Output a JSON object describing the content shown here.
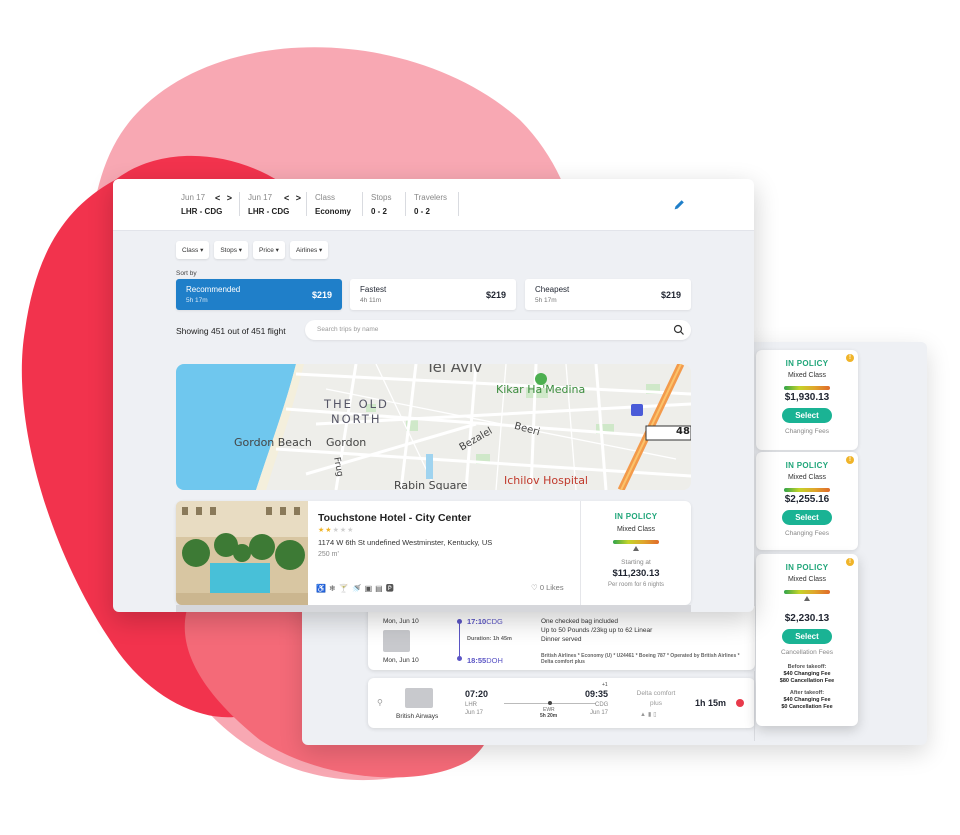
{
  "colors": {
    "accent": "#1f7fc9",
    "policy_green": "#21a67a",
    "select_teal": "#1ab394",
    "blob_red": "#f2334d",
    "blob_pink": "#f8a8b3"
  },
  "search_bar": {
    "departure": {
      "date": "Jun 17",
      "route": "LHR - CDG"
    },
    "return": {
      "date": "Jun 17",
      "route": "LHR - CDG"
    },
    "class": {
      "label": "Class",
      "value": "Economy"
    },
    "stops": {
      "label": "Stops",
      "value": "0 - 2"
    },
    "travelers": {
      "label": "Travelers",
      "value": "0 - 2"
    },
    "nav_arrows": "< >",
    "edit_icon": "pencil-icon"
  },
  "filters": [
    "Class",
    "Stops",
    "Price",
    "Airlines"
  ],
  "sort": {
    "label": "Sort by",
    "options": [
      {
        "name": "Recommended",
        "time": "5h 17m",
        "price": "$219",
        "active": true
      },
      {
        "name": "Fastest",
        "time": "4h 11m",
        "price": "$219",
        "active": false
      },
      {
        "name": "Cheapest",
        "time": "5h 17m",
        "price": "$219",
        "active": false
      }
    ]
  },
  "results": {
    "showing": "Showing 451 out of 451 flight",
    "search_placeholder": "Search trips by name"
  },
  "map": {
    "labels": [
      "Tel Aviv",
      "Kikar Ha'Medina",
      "THE OLD",
      "NORTH",
      "Gordon Beach",
      "Gordon",
      "Bezalel",
      "Beeri",
      "Frug",
      "Ichilov Hospital",
      "Rabin Square",
      "48"
    ]
  },
  "hotel": {
    "name": "Touchstone Hotel - City Center",
    "stars": 2,
    "stars_total": 5,
    "address": "1174 W 6th St undefined Westminster, Kentucky, US",
    "distance": "250 m'",
    "amenities": [
      "wheelchair-icon",
      "snowflake-icon",
      "cocktail-icon",
      "shower-icon",
      "tv-icon",
      "washer-icon",
      "parking-icon"
    ],
    "likes": "0 Likes",
    "policy": {
      "status": "IN POLICY",
      "class": "Mixed Class",
      "starting_label": "Starting at",
      "amount": "$11,230.13",
      "note": "Per room for 6 nights"
    }
  },
  "side_cards": [
    {
      "status": "IN POLICY",
      "class": "Mixed Class",
      "amount": "$1,930.13",
      "select": "Select",
      "fee": "Changing Fees"
    },
    {
      "status": "IN POLICY",
      "class": "Mixed Class",
      "amount": "$2,255.16",
      "select": "Select",
      "fee": "Changing Fees"
    },
    {
      "status": "IN POLICY",
      "class": "Mixed Class",
      "amount": "$2,230.13",
      "select": "Select",
      "fee": "Cancellation Fees",
      "before": {
        "title": "Before takeoff:",
        "l1": "$40 Changing Fee",
        "l2": "$80 Cancellation Fee"
      },
      "after": {
        "title": "After takeoff:",
        "l1": "$40 Changing Fee",
        "l2": "$0 Cancellation Fee"
      }
    }
  ],
  "flight_detail": {
    "dep_date": "Mon, Jun 10",
    "arr_date": "Mon, Jun 10",
    "dep_time": "17:10",
    "dep_code": "CDG",
    "duration": "Duration: 1h 45m",
    "arr_time": "18:55",
    "arr_code": "DOH",
    "baggage1": "One checked bag included",
    "baggage2": "Up to 50 Pounds /23kg up to 62 Linear",
    "dinner": "Dinner served",
    "operator": "British Airlines * Economy (U) * U24461 * Boeing 787 * Operated by British Airlines * Delta comfort plus"
  },
  "flight_row": {
    "airline": "British Airways",
    "dep_time": "07:20",
    "dep_code": "LHR",
    "dep_date": "Jun 17",
    "stop_code": "EWR",
    "stop_time": "5h 20m",
    "arr_time": "09:35",
    "plus_day": "+1",
    "arr_code": "CDG",
    "arr_date": "Jun 17",
    "fare": "Delta comfort plus",
    "duration": "1h 15m"
  }
}
